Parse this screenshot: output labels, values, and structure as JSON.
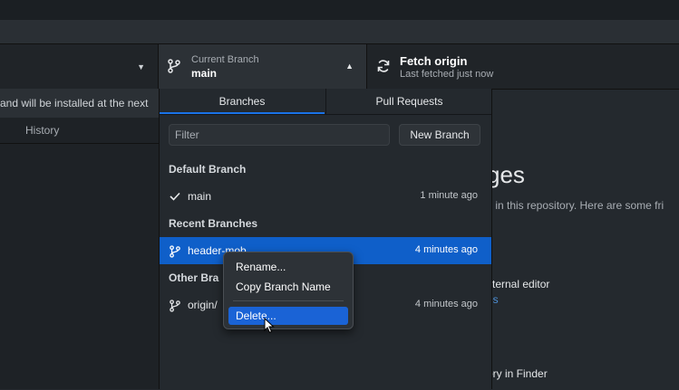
{
  "toolbar": {
    "current_branch_label": "Current Branch",
    "current_branch_value": "main",
    "fetch_label": "Fetch origin",
    "fetch_sub": "Last fetched just now"
  },
  "left": {
    "notice_text": "and will be installed at the next",
    "history_tab": "History"
  },
  "background": {
    "title_fragment": "ges",
    "desc_fragment": "s in this repository. Here are some fri",
    "editor_fragment": "xternal editor",
    "link_fragment": "es",
    "finder_fragment": "ory in Finder"
  },
  "dropdown": {
    "tabs": [
      "Branches",
      "Pull Requests"
    ],
    "filter_placeholder": "Filter",
    "new_branch_button": "New Branch",
    "default_section": "Default Branch",
    "default_branch": {
      "name": "main",
      "time": "1 minute ago"
    },
    "recent_section": "Recent Branches",
    "recent_branch": {
      "name": "header-mob",
      "time": "4 minutes ago"
    },
    "other_section": "Other Bra",
    "other_branch": {
      "name": "origin/",
      "time": "4 minutes ago"
    }
  },
  "context_menu": {
    "items": [
      "Rename...",
      "Copy Branch Name",
      "Delete..."
    ]
  },
  "colors": {
    "accent": "#1a73e8",
    "selected_row": "#0f5fc9",
    "menu_highlight": "#1a63d6"
  },
  "icons": [
    "branch-icon",
    "sync-icon",
    "check-icon",
    "chevron-down-icon",
    "chevron-up-icon",
    "mouse-pointer-icon"
  ]
}
